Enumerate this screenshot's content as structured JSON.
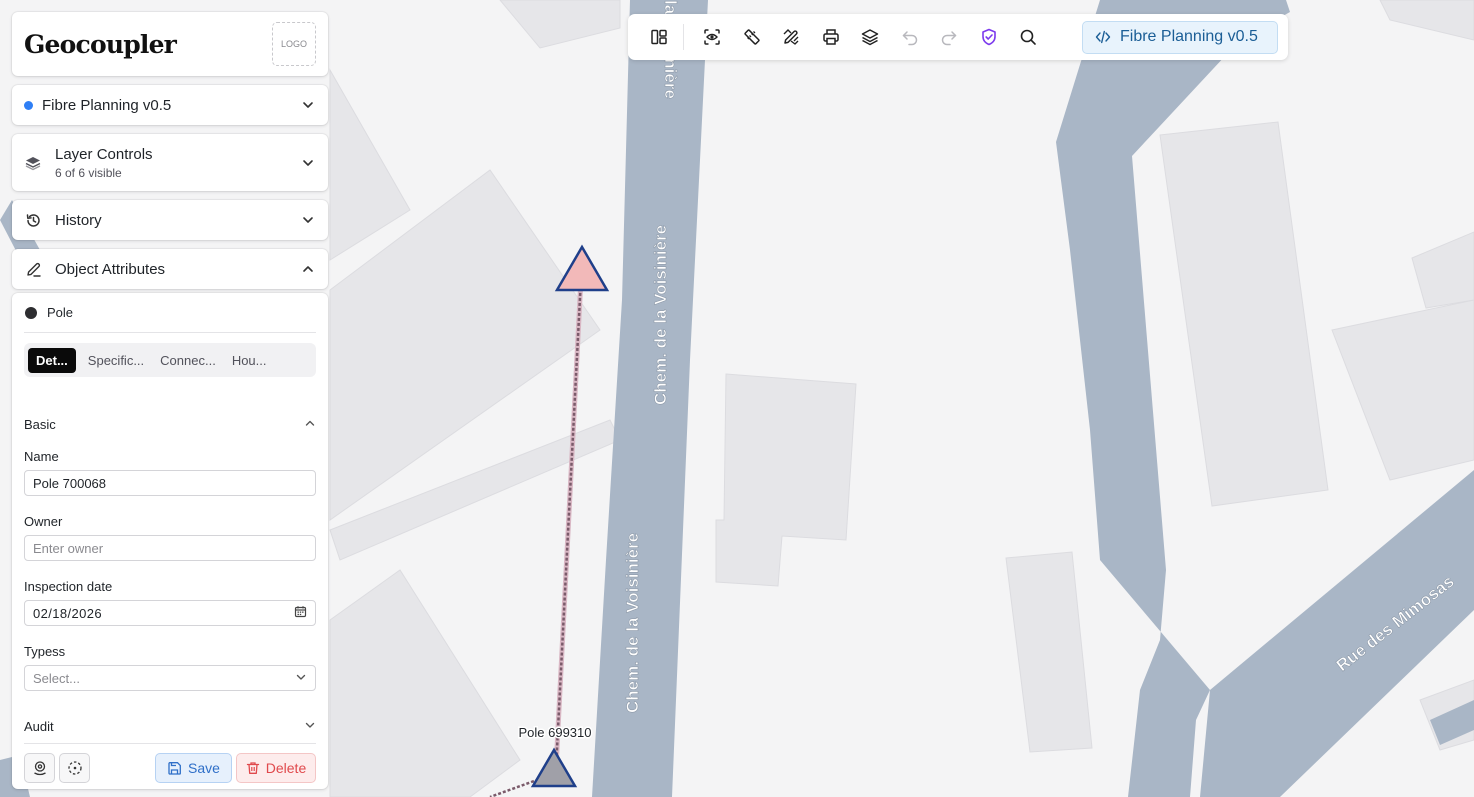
{
  "app": {
    "brand": "Geocoupler",
    "logo_text": "LOGO"
  },
  "project": {
    "name": "Fibre Planning v0.5",
    "status_color": "#2f7ff5"
  },
  "panels": {
    "layers": {
      "title": "Layer Controls",
      "subtitle": "6 of 6 visible"
    },
    "history": {
      "title": "History"
    },
    "object_attributes": {
      "title": "Object Attributes"
    }
  },
  "object": {
    "type": "Pole",
    "tabs": [
      {
        "label": "Det...",
        "active": true
      },
      {
        "label": "Specific...",
        "active": false
      },
      {
        "label": "Connec...",
        "active": false
      },
      {
        "label": "Hou...",
        "active": false
      }
    ],
    "sections": {
      "basic": "Basic",
      "audit": "Audit"
    },
    "fields": {
      "name": {
        "label": "Name",
        "value": "Pole 700068"
      },
      "owner": {
        "label": "Owner",
        "placeholder": "Enter owner"
      },
      "inspection_date": {
        "label": "Inspection date",
        "value": "02/18/2026"
      },
      "typess": {
        "label": "Typess",
        "placeholder": "Select..."
      }
    },
    "actions": {
      "save": "Save",
      "delete": "Delete"
    }
  },
  "toolbar": {
    "icons": [
      "layout-panels-icon",
      "focus-view-icon",
      "measure-ruler-icon",
      "draw-tools-icon",
      "print-icon",
      "layers-icon",
      "undo-icon",
      "redo-icon",
      "shield-check-icon",
      "search-icon"
    ],
    "project_label": "Fibre Planning v0.5",
    "accent": "#7c3aed"
  },
  "map": {
    "street_labels": [
      "Chem. de la Voisinière",
      "Chem. de la Voisinière",
      "Rue des Mimosas"
    ],
    "feature_label": "Pole 699310",
    "colors": {
      "road": "#a9b6c6",
      "building": "#e5e5e8",
      "background": "#f4f4f5",
      "pole_fill": "#f2b9b9",
      "pole_stroke": "#1f3f8a",
      "cable": "#7a5a6a"
    }
  }
}
